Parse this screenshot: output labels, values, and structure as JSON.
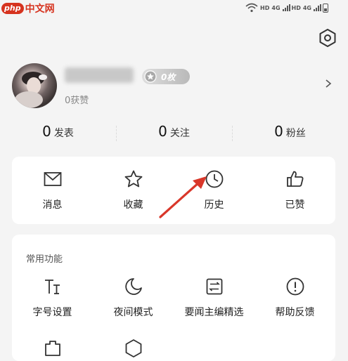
{
  "watermark": {
    "badge": "php",
    "text": "中文网"
  },
  "status_bar": {
    "hd1": "HD",
    "net1": "4G",
    "hd2": "HD",
    "net2": "4G"
  },
  "profile": {
    "username": "xxxxxx",
    "medal_count": "0枚",
    "likes": "0获赞"
  },
  "stats": [
    {
      "count": "0",
      "label": "发表"
    },
    {
      "count": "0",
      "label": "关注"
    },
    {
      "count": "0",
      "label": "粉丝"
    }
  ],
  "shortcuts": [
    {
      "label": "消息",
      "icon": "message-icon"
    },
    {
      "label": "收藏",
      "icon": "star-icon"
    },
    {
      "label": "历史",
      "icon": "clock-icon"
    },
    {
      "label": "已赞",
      "icon": "thumbs-up-icon"
    }
  ],
  "features": {
    "title": "常用功能",
    "items": [
      {
        "label": "字号设置",
        "icon": "font-size-icon"
      },
      {
        "label": "夜间模式",
        "icon": "moon-icon"
      },
      {
        "label": "要闻主编精选",
        "icon": "editor-picks-icon"
      },
      {
        "label": "帮助反馈",
        "icon": "help-icon"
      }
    ],
    "row2_icons": [
      "puzzle-icon",
      "shield-icon"
    ]
  },
  "colors": {
    "accent_arrow": "#d9372a",
    "watermark": "#d6331f"
  }
}
